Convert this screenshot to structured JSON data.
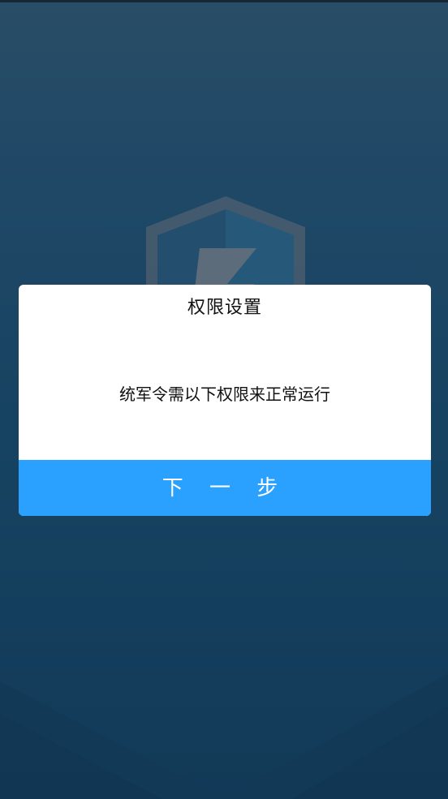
{
  "dialog": {
    "title": "权限设置",
    "message": "统军令需以下权限来正常运行",
    "next_button_label": "下 一 步"
  },
  "icons": {
    "logo": "shield-logo-icon"
  },
  "colors": {
    "background_top": "#2f5670",
    "background_bottom": "#14405f",
    "dialog_background": "#ffffff",
    "button_background": "#2ba1ff",
    "button_text": "#ffffff",
    "title_text": "#111111"
  }
}
